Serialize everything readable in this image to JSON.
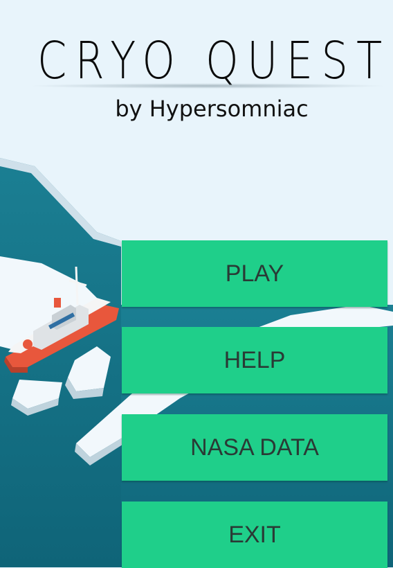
{
  "header": {
    "title": "CRYO QUEST",
    "subtitle": "by Hypersomniac"
  },
  "menu": {
    "play_label": "PLAY",
    "help_label": "HELP",
    "nasa_data_label": "NASA DATA",
    "exit_label": "EXIT"
  },
  "colors": {
    "sky": "#e8f4fb",
    "ocean": "#136f84",
    "ice": "#f2f8fc",
    "button": "#1fcf8a",
    "ship_hull": "#e8573c"
  },
  "scene": {
    "vehicle": "icebreaker-ship",
    "elements": [
      "ocean",
      "ice-floes",
      "iceberg"
    ]
  }
}
